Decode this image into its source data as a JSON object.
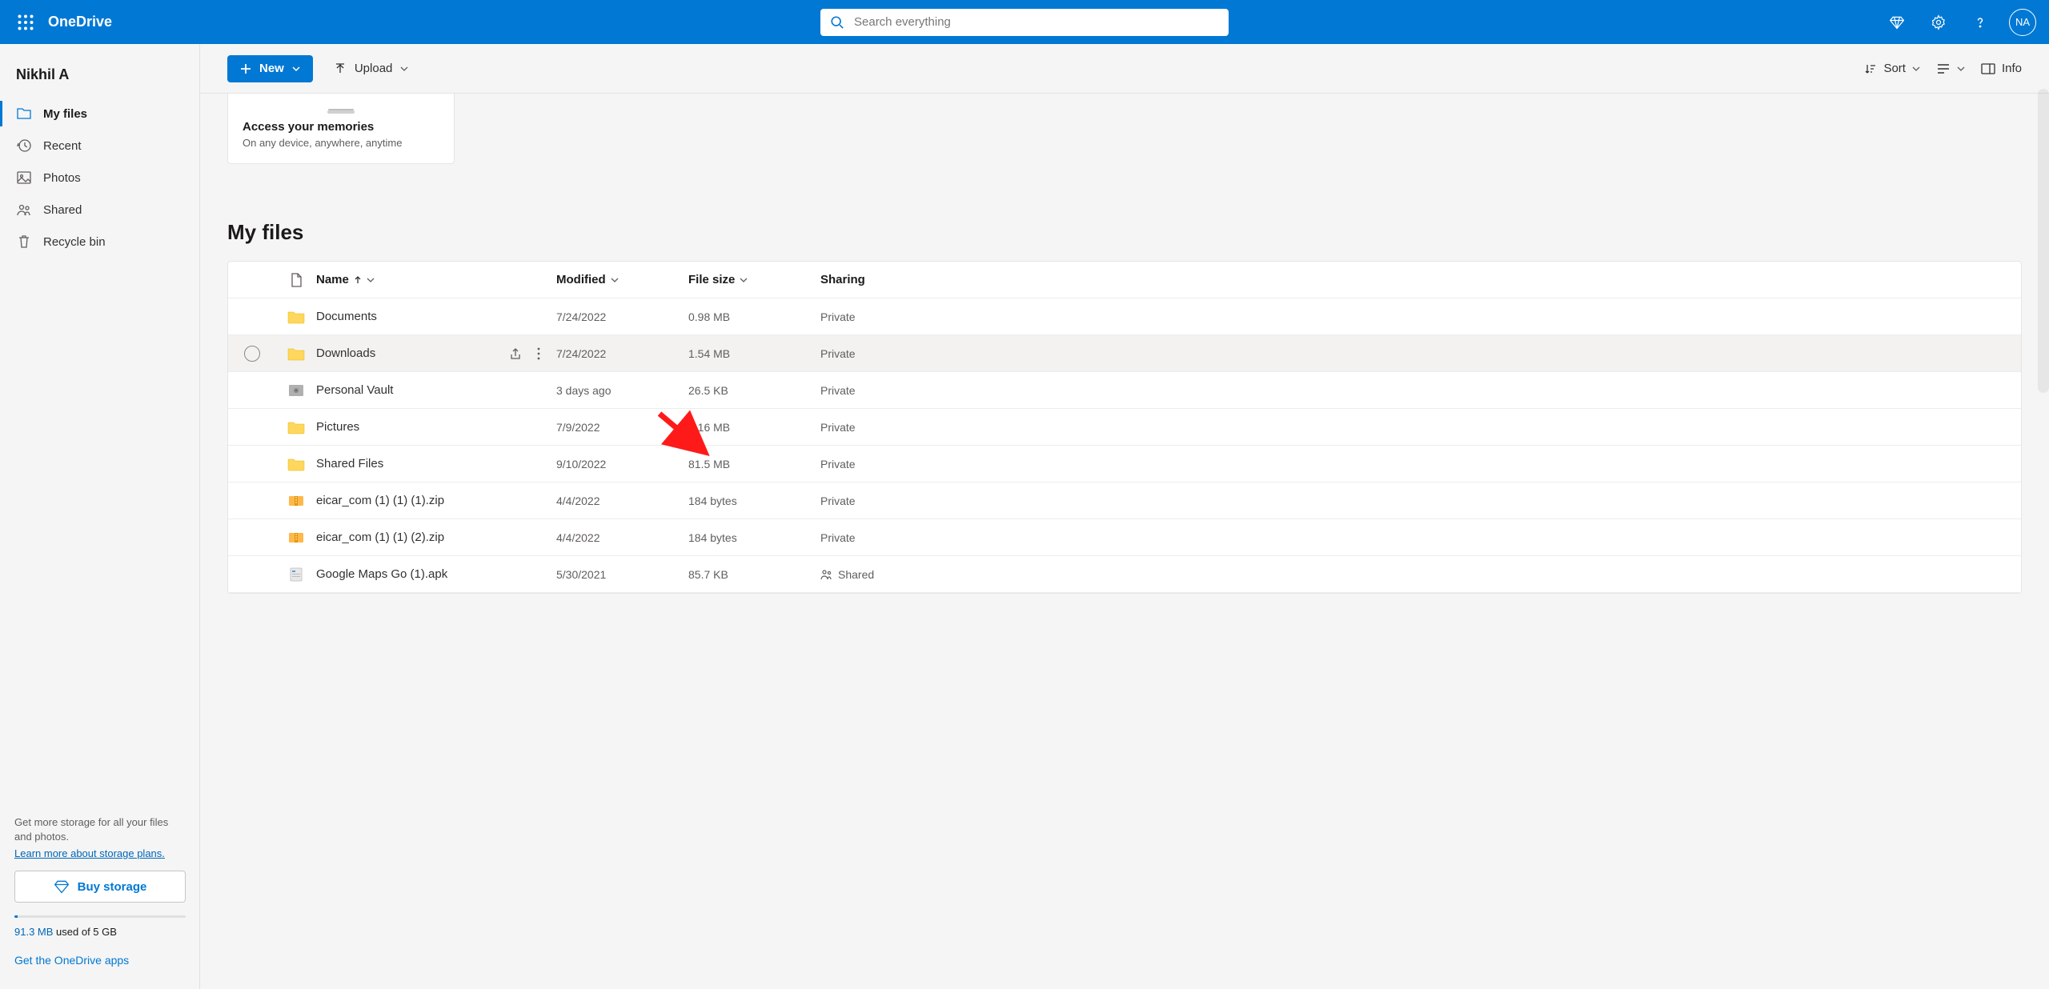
{
  "header": {
    "brand": "OneDrive",
    "search_placeholder": "Search everything",
    "avatar_initials": "NA"
  },
  "sidebar": {
    "user_name": "Nikhil A",
    "nav": [
      {
        "label": "My files",
        "icon": "folder-icon",
        "active": true
      },
      {
        "label": "Recent",
        "icon": "recent-icon",
        "active": false
      },
      {
        "label": "Photos",
        "icon": "photos-icon",
        "active": false
      },
      {
        "label": "Shared",
        "icon": "shared-icon",
        "active": false
      },
      {
        "label": "Recycle bin",
        "icon": "recycle-icon",
        "active": false
      }
    ],
    "storage_text": "Get more storage for all your files and photos.",
    "storage_link": "Learn more about storage plans.",
    "buy_storage_label": "Buy storage",
    "used_amount": "91.3 MB",
    "used_suffix": "used of 5 GB",
    "get_apps": "Get the OneDrive apps"
  },
  "toolbar": {
    "new_label": "New",
    "upload_label": "Upload",
    "sort_label": "Sort",
    "info_label": "Info"
  },
  "memories": {
    "title": "Access your memories",
    "subtitle": "On any device, anywhere, anytime"
  },
  "section_title": "My files",
  "columns": {
    "name": "Name",
    "modified": "Modified",
    "size": "File size",
    "sharing": "Sharing"
  },
  "files": [
    {
      "type": "folder",
      "name": "Documents",
      "modified": "7/24/2022",
      "size": "0.98 MB",
      "sharing": "Private",
      "hover": false
    },
    {
      "type": "folder",
      "name": "Downloads",
      "modified": "7/24/2022",
      "size": "1.54 MB",
      "sharing": "Private",
      "hover": true
    },
    {
      "type": "vault",
      "name": "Personal Vault",
      "modified": "3 days ago",
      "size": "26.5 KB",
      "sharing": "Private",
      "hover": false
    },
    {
      "type": "folder",
      "name": "Pictures",
      "modified": "7/9/2022",
      "size": "7.16 MB",
      "sharing": "Private",
      "hover": false
    },
    {
      "type": "folder",
      "name": "Shared Files",
      "modified": "9/10/2022",
      "size": "81.5 MB",
      "sharing": "Private",
      "hover": false
    },
    {
      "type": "zip",
      "name": "eicar_com (1) (1) (1).zip",
      "modified": "4/4/2022",
      "size": "184 bytes",
      "sharing": "Private",
      "hover": false
    },
    {
      "type": "zip",
      "name": "eicar_com (1) (1) (2).zip",
      "modified": "4/4/2022",
      "size": "184 bytes",
      "sharing": "Private",
      "hover": false
    },
    {
      "type": "apk",
      "name": "Google Maps Go (1).apk",
      "modified": "5/30/2021",
      "size": "85.7 KB",
      "sharing": "Shared",
      "hover": false
    }
  ]
}
